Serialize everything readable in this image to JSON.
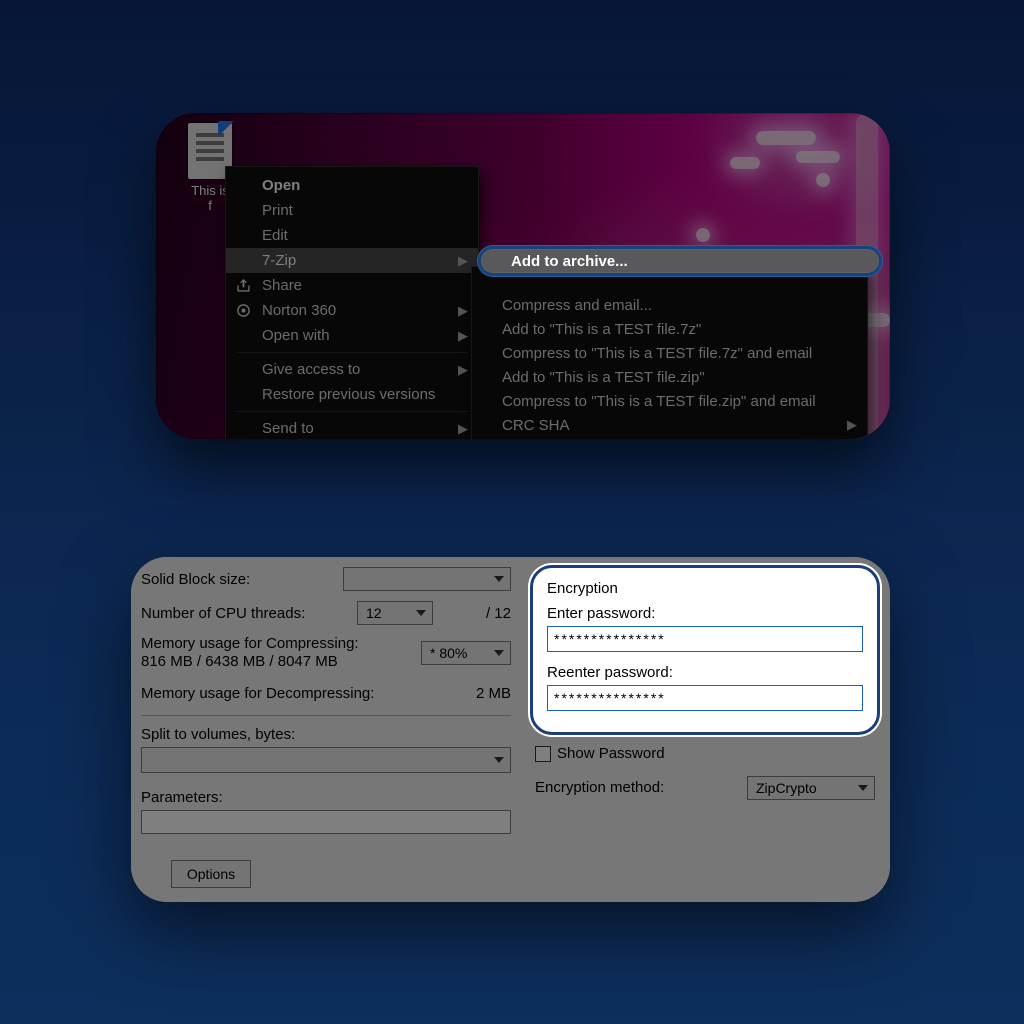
{
  "panel1": {
    "file_icon_label": "This is\nf",
    "context_menu": {
      "open": "Open",
      "print": "Print",
      "edit": "Edit",
      "sevenzip": "7-Zip",
      "share": "Share",
      "norton": "Norton 360",
      "open_with": "Open with",
      "give_access": "Give access to",
      "restore": "Restore previous versions",
      "send_to": "Send to"
    },
    "submenu": {
      "add_archive": "Add to archive...",
      "compress_email": "Compress and email...",
      "add_to_7z": "Add to \"This is a TEST file.7z\"",
      "compress_7z_email": "Compress to \"This is a TEST file.7z\" and email",
      "add_to_zip": "Add to \"This is a TEST file.zip\"",
      "compress_zip_email": "Compress to \"This is a TEST file.zip\" and email",
      "crc_sha": "CRC SHA"
    }
  },
  "panel2": {
    "labels": {
      "solid_block": "Solid Block size:",
      "cpu_threads": "Number of CPU threads:",
      "cpu_value": "12",
      "cpu_total": "/ 12",
      "mem_compress_label": "Memory usage for Compressing:",
      "mem_compress_values": "816 MB / 6438 MB / 8047 MB",
      "mem_compress_pct": "* 80%",
      "mem_decompress_label": "Memory usage for Decompressing:",
      "mem_decompress_value": "2 MB",
      "split_volumes": "Split to volumes, bytes:",
      "parameters": "Parameters:",
      "options_btn": "Options"
    },
    "encryption": {
      "group_title": "Encryption",
      "enter_pw": "Enter password:",
      "reenter_pw": "Reenter password:",
      "pw_value": "***************",
      "show_pw": "Show Password",
      "method_label": "Encryption method:",
      "method_value": "ZipCrypto"
    }
  }
}
